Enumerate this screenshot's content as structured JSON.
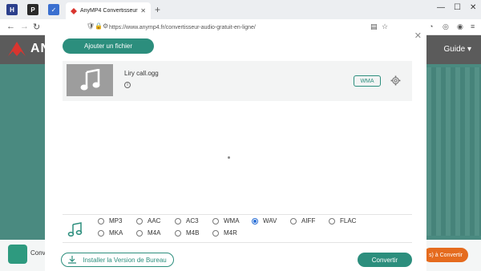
{
  "browser": {
    "tab_title": "AnyMP4 Convertisseur Audio G",
    "url": "https://www.anymp4.fr/convertisseur-audio-gratuit-en-ligne/",
    "pinned": [
      {
        "letter": "H",
        "color": "#2b3f8c"
      },
      {
        "letter": "P",
        "color": "#2a2a2a"
      },
      {
        "letter": "✓",
        "color": "#3a6fd0"
      }
    ]
  },
  "site": {
    "brand": "AN",
    "guide": "Guide ▾",
    "strip_text": "Conv",
    "strip_button": "s) à Convertir"
  },
  "modal": {
    "add_button": "Ajouter un fichier",
    "file": {
      "name": "Liry call.ogg",
      "format": "WMA"
    },
    "formats": [
      {
        "label": "MP3",
        "selected": false
      },
      {
        "label": "AAC",
        "selected": false
      },
      {
        "label": "AC3",
        "selected": false
      },
      {
        "label": "WMA",
        "selected": false
      },
      {
        "label": "WAV",
        "selected": true
      },
      {
        "label": "AIFF",
        "selected": false
      },
      {
        "label": "FLAC",
        "selected": false
      },
      {
        "label": "MKA",
        "selected": false
      },
      {
        "label": "M4A",
        "selected": false
      },
      {
        "label": "M4B",
        "selected": false
      },
      {
        "label": "M4R",
        "selected": false
      }
    ],
    "install_button": "Installer la Version de Bureau",
    "convert_button": "Convertir"
  },
  "colors": {
    "accent": "#2c8e7d",
    "radio_selected": "#2a6fd6",
    "orange": "#e56b1e"
  }
}
